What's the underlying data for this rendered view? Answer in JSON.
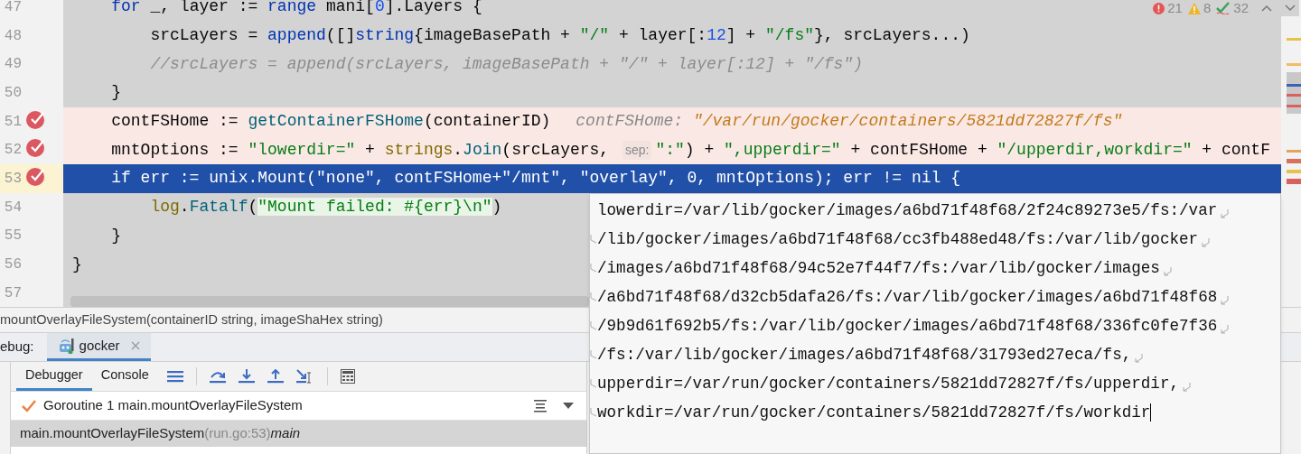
{
  "inspections": {
    "errors": "21",
    "warnings": "8",
    "weak_warnings": "32"
  },
  "code_lines": [
    {
      "number": "47",
      "kind": "normal",
      "tokens": [
        {
          "kind": "keyword",
          "text": "    for"
        },
        {
          "kind": "text",
          "text": " _, layer := "
        },
        {
          "kind": "keyword",
          "text": "range"
        },
        {
          "kind": "text",
          "text": " mani["
        },
        {
          "kind": "number",
          "text": "0"
        },
        {
          "kind": "text",
          "text": "].Layers {"
        }
      ]
    },
    {
      "number": "48",
      "kind": "normal",
      "tokens": [
        {
          "kind": "text",
          "text": "        srcLayers = "
        },
        {
          "kind": "keyword",
          "text": "append"
        },
        {
          "kind": "text",
          "text": "([]"
        },
        {
          "kind": "keyword",
          "text": "string"
        },
        {
          "kind": "text",
          "text": "{imageBasePath + "
        },
        {
          "kind": "string",
          "text": "\"/\""
        },
        {
          "kind": "text",
          "text": " + layer[:"
        },
        {
          "kind": "number",
          "text": "12"
        },
        {
          "kind": "text",
          "text": "] + "
        },
        {
          "kind": "string",
          "text": "\"/fs\""
        },
        {
          "kind": "text",
          "text": "}, srcLayers...)"
        }
      ]
    },
    {
      "number": "49",
      "kind": "normal",
      "tokens": [
        {
          "kind": "comment",
          "text": "        //srcLayers = append(srcLayers, imageBasePath + \"/\" + layer[:12] + \"/fs\")"
        }
      ]
    },
    {
      "number": "50",
      "kind": "normal",
      "tokens": [
        {
          "kind": "text",
          "text": "    }"
        }
      ]
    },
    {
      "number": "51",
      "kind": "breakpoint",
      "tokens": [
        {
          "kind": "text",
          "text": "    contFSHome := "
        },
        {
          "kind": "function",
          "text": "getContainerFSHome"
        },
        {
          "kind": "text",
          "text": "(containerID)"
        },
        {
          "kind": "hint_label",
          "text": "contFSHome:"
        },
        {
          "kind": "hint_value",
          "text": "\"/var/run/gocker/containers/5821dd72827f/fs\""
        }
      ]
    },
    {
      "number": "52",
      "kind": "breakpoint",
      "tokens": [
        {
          "kind": "text",
          "text": "    mntOptions := "
        },
        {
          "kind": "string",
          "text": "\"lowerdir=\""
        },
        {
          "kind": "text",
          "text": " + "
        },
        {
          "kind": "package",
          "text": "strings"
        },
        {
          "kind": "text",
          "text": "."
        },
        {
          "kind": "function",
          "text": "Join"
        },
        {
          "kind": "text",
          "text": "(srcLayers, "
        },
        {
          "kind": "param_hint",
          "text": "sep:"
        },
        {
          "kind": "string",
          "text": "\":\""
        },
        {
          "kind": "text",
          "text": ") + "
        },
        {
          "kind": "string",
          "text": "\",upperdir=\""
        },
        {
          "kind": "text",
          "text": " + contFSHome + "
        },
        {
          "kind": "string",
          "text": "\"/upperdir,workdir=\""
        },
        {
          "kind": "text",
          "text": " + contF"
        }
      ]
    },
    {
      "number": "53",
      "kind": "current",
      "tokens": [
        {
          "kind": "text",
          "text": "    if err := unix.Mount(\"none\", contFSHome+\"/mnt\", \"overlay\", 0, mntOptions); err != nil {"
        }
      ]
    },
    {
      "number": "54",
      "kind": "normal",
      "tokens": [
        {
          "kind": "package",
          "text": "        log"
        },
        {
          "kind": "text",
          "text": "."
        },
        {
          "kind": "function",
          "text": "Fatalf"
        },
        {
          "kind": "text",
          "text": "("
        },
        {
          "kind": "marked_string",
          "text": "\"Mount failed: #{err}\\n\""
        },
        {
          "kind": "text",
          "text": ")"
        }
      ]
    },
    {
      "number": "55",
      "kind": "normal",
      "tokens": [
        {
          "kind": "text",
          "text": "    }"
        }
      ]
    },
    {
      "number": "56",
      "kind": "normal",
      "tokens": [
        {
          "kind": "text",
          "text": "}"
        }
      ]
    },
    {
      "number": "57",
      "kind": "normal"
    }
  ],
  "breadcrumb": "mountOverlayFileSystem(containerID string, imageShaHex string)",
  "debug_bar": {
    "label": "ebug:",
    "tabs": [
      {
        "label": "gocker",
        "selected": true
      }
    ]
  },
  "debugger_tabs": [
    {
      "label": "Debugger",
      "selected": true
    },
    {
      "label": "Console",
      "selected": false
    }
  ],
  "goroutine": "Goroutine 1 main.mountOverlayFileSystem",
  "frames": [
    {
      "function": "main.mountOverlayFileSystem",
      "location": "(run.go:53)",
      "goroutine": "main",
      "selected": true
    }
  ],
  "value_popup": {
    "lines": [
      {
        "text": "lowerdir=/var/lib/gocker/images/a6bd71f48f68/2f24c89273e5/fs:/var",
        "continued": false,
        "wraps": true
      },
      {
        "text": "/lib/gocker/images/a6bd71f48f68/cc3fb488ed48/fs:/var/lib/gocker",
        "continued": true,
        "wraps": true
      },
      {
        "text": "/images/a6bd71f48f68/94c52e7f44f7/fs:/var/lib/gocker/images",
        "continued": true,
        "wraps": true
      },
      {
        "text": "/a6bd71f48f68/d32cb5dafa26/fs:/var/lib/gocker/images/a6bd71f48f68",
        "continued": true,
        "wraps": true
      },
      {
        "text": "/9b9d61f692b5/fs:/var/lib/gocker/images/a6bd71f48f68/336fc0fe7f36",
        "continued": true,
        "wraps": true
      },
      {
        "text": "/fs:/var/lib/gocker/images/a6bd71f48f68/31793ed27eca/fs,",
        "continued": true,
        "wraps": true
      },
      {
        "text": "upperdir=/var/run/gocker/containers/5821dd72827f/fs/upperdir,",
        "continued": true,
        "wraps": true
      },
      {
        "text": "workdir=/var/run/gocker/containers/5821dd72827f/fs/workdir",
        "continued": true,
        "wraps": false
      }
    ]
  }
}
